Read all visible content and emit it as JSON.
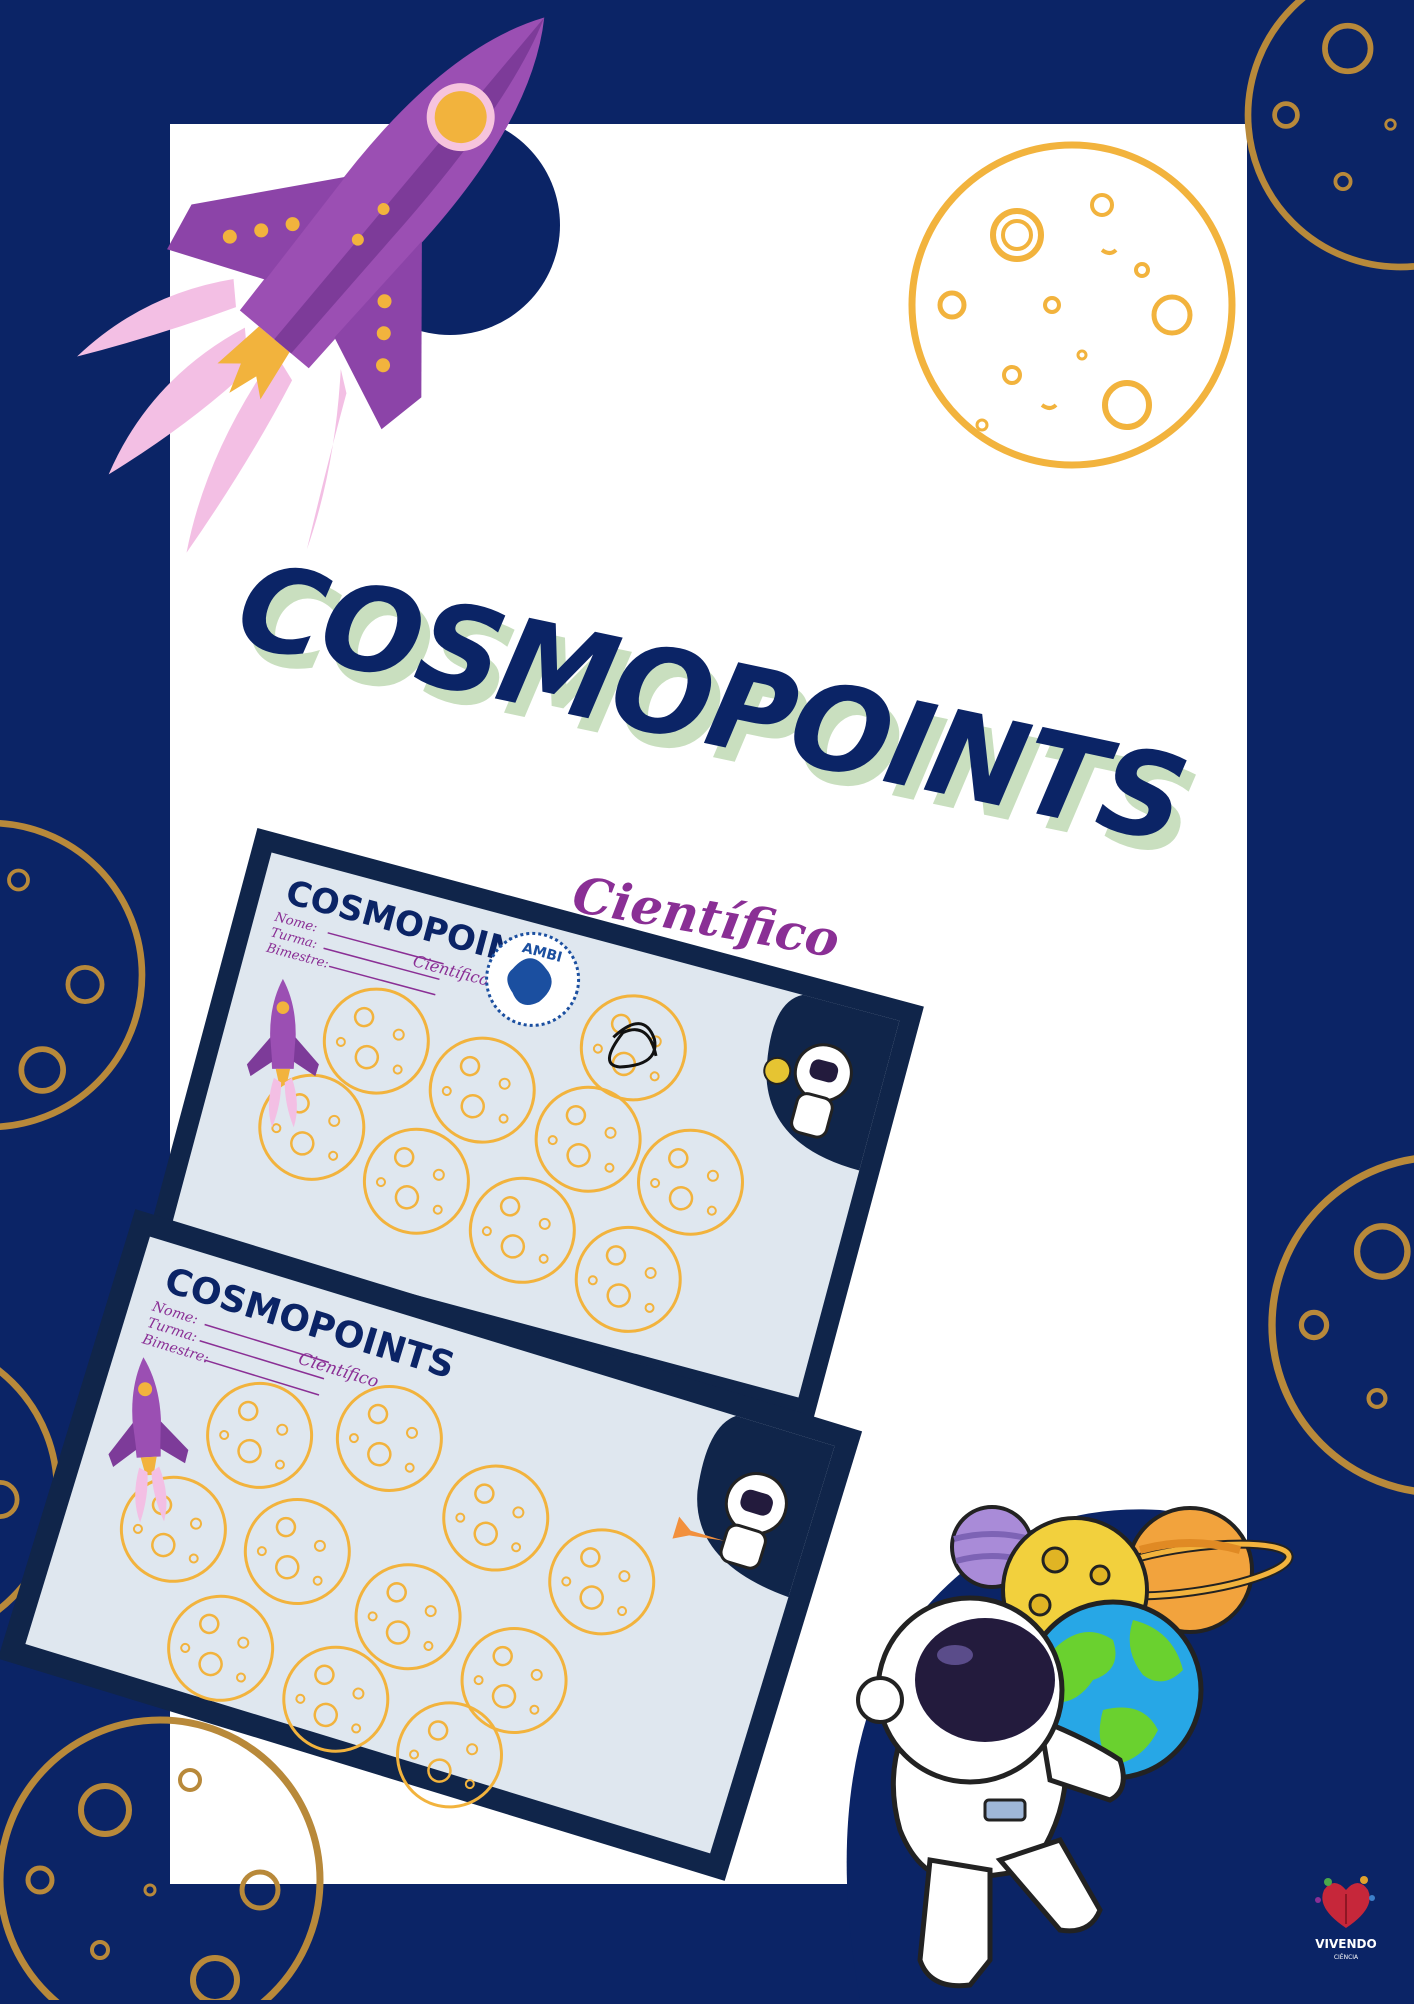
{
  "poster": {
    "title": "COSMOPOINTS",
    "subtitle": "Científico"
  },
  "cards": [
    {
      "title": "COSMOPOINTS",
      "subtitle": "Científico",
      "fields": [
        "Nome:",
        "Turma:",
        "Bimestre:"
      ],
      "stamp_text": "AMBI"
    },
    {
      "title": "COSMOPOINTS",
      "subtitle": "Científico",
      "fields": [
        "Nome:",
        "Turma:",
        "Bimestre:"
      ]
    }
  ],
  "brand": {
    "name": "VIVENDO",
    "tagline": "CIÊNCIA"
  },
  "colors": {
    "navy": "#0b2466",
    "white": "#ffffff",
    "moon_gold": "#f2b33d",
    "rocket_purple": "#9b4fb3",
    "subtitle_purple": "#8a2f95",
    "title_shadow": "#c9dfbf",
    "card_face": "#dfe7ef",
    "card_edge": "#10254a"
  },
  "icons": [
    "rocket-icon",
    "moon-icon",
    "astronaut-icon",
    "planet-icon",
    "earth-icon",
    "brand-logo-icon"
  ]
}
